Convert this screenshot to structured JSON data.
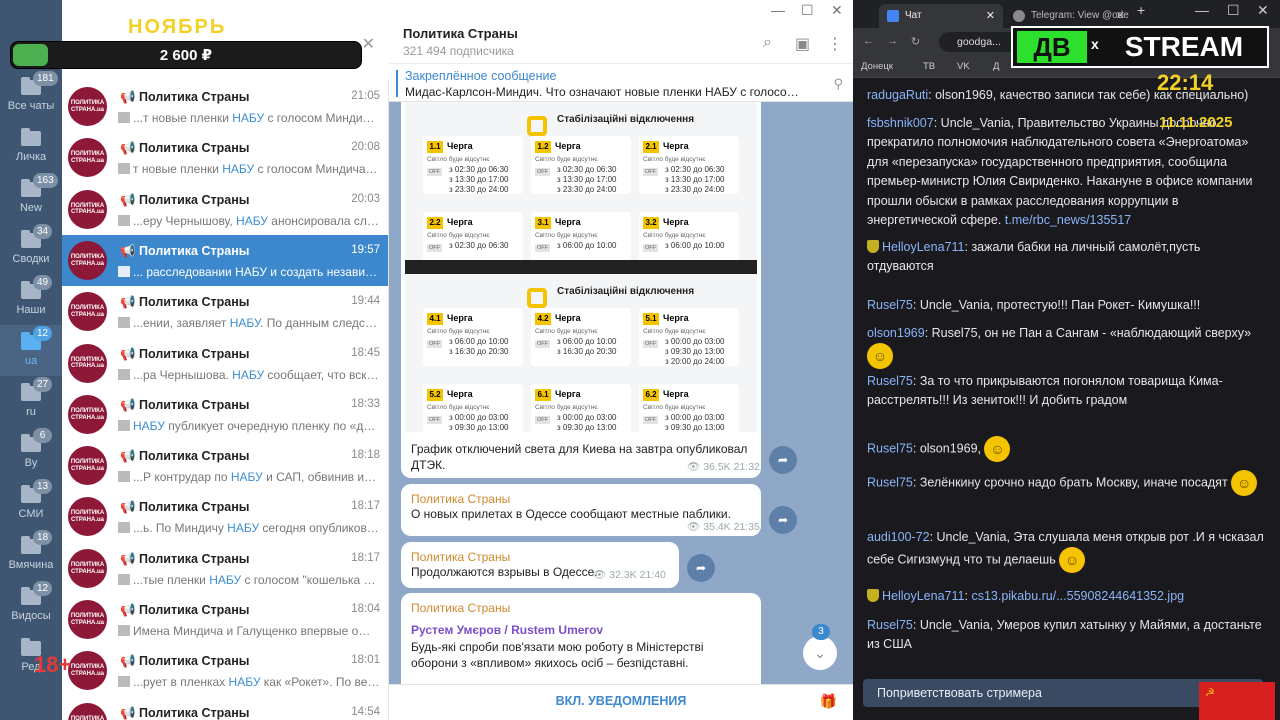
{
  "folders": [
    {
      "label": "Все чаты",
      "badge": "181"
    },
    {
      "label": "Личка",
      "badge": ""
    },
    {
      "label": "New",
      "badge": "163"
    },
    {
      "label": "Сводки",
      "badge": "34"
    },
    {
      "label": "Наши",
      "badge": "49"
    },
    {
      "label": "ua",
      "badge": "12"
    },
    {
      "label": "ru",
      "badge": "27"
    },
    {
      "label": "By",
      "badge": "6"
    },
    {
      "label": "СМИ",
      "badge": "13"
    },
    {
      "label": "Вмячина",
      "badge": "18"
    },
    {
      "label": "Видосы",
      "badge": "12"
    },
    {
      "label": "Ред",
      "badge": ""
    }
  ],
  "overlay": {
    "month": "НОЯБРЬ",
    "price": "2 600 ₽",
    "progress_fraction": 0.1,
    "age": "18+"
  },
  "chats": [
    {
      "name": "Политика Страны",
      "time": "21:05",
      "pre": "...т новые пленки ",
      "hl": "НАБУ",
      "post": " с голосом Миндича и ..."
    },
    {
      "name": "Политика Страны",
      "time": "20:08",
      "pre": "т новые пленки ",
      "hl": "НАБУ",
      "post": " с голосом Миндича и как..."
    },
    {
      "name": "Политика Страны",
      "time": "20:03",
      "pre": "...еру Чернышову, ",
      "hl": "НАБУ",
      "post": " анонсировала следу..."
    },
    {
      "name": "Политика Страны",
      "time": "19:57",
      "pre": "... расследовании ",
      "hl": "НАБУ",
      "post": " и создать независим..."
    },
    {
      "name": "Политика Страны",
      "time": "19:44",
      "pre": "...ении, заявляет ",
      "hl": "НАБУ",
      "post": ". По данным следствия..."
    },
    {
      "name": "Политика Страны",
      "time": "18:45",
      "pre": "...ра Чернышова. ",
      "hl": "НАБУ",
      "post": " сообщает, что вскоре..."
    },
    {
      "name": "Политика Страны",
      "time": "18:33",
      "pre": "",
      "hl": "НАБУ",
      "post": " публикует очередную пленку по «делу..."
    },
    {
      "name": "Политика Страны",
      "time": "18:18",
      "pre": "...Р контрудар по ",
      "hl": "НАБУ",
      "post": " и САП, обвинив их в руков..."
    },
    {
      "name": "Политика Страны",
      "time": "18:17",
      "pre": "...ь. По Миндичу ",
      "hl": "НАБУ",
      "post": " сегодня опубликовало от..."
    },
    {
      "name": "Политика Страны",
      "time": "18:17",
      "pre": "...тые пленки ",
      "hl": "НАБУ",
      "post": " с голосом \"кошелька Зел..."
    },
    {
      "name": "Политика Страны",
      "time": "18:04",
      "pre": "Имена Миндича и Галущенко впервые офиц...",
      "hl": "",
      "post": ""
    },
    {
      "name": "Политика Страны",
      "time": "18:01",
      "pre": "...рует в пленках ",
      "hl": "НАБУ",
      "post": " как «Рокет». По верси..."
    },
    {
      "name": "Политика Страны",
      "time": "14:54",
      "pre": "",
      "hl": "",
      "post": ""
    }
  ],
  "avatar_text": "ПОЛИТИКА СТРАНА.ua",
  "header": {
    "title": "Политика Страны",
    "subscribers": "321 494 подписчика"
  },
  "pinned": {
    "title": "Закреплённое сообщение",
    "text": "Мидас-Карлсон-Миндич. Что означают новые пленки НАБУ с голосом \"ко..."
  },
  "schedule": {
    "title": "Стабілізаційні відключення",
    "queue_word": "Черга",
    "no_light": "Світло буде відсутнє",
    "off": "OFF",
    "card1": [
      {
        "n": "1.1",
        "t": [
          "з 02:30 до 06:30",
          "з 13:30 до 17:00",
          "з 23:30 до 24:00"
        ]
      },
      {
        "n": "1.2",
        "t": [
          "з 02:30 до 06:30",
          "з 13:30 до 17:00",
          "з 23:30 до 24:00"
        ]
      },
      {
        "n": "2.1",
        "t": [
          "з 02:30 до 06:30",
          "з 13:30 до 17:00",
          "з 23:30 до 24:00"
        ]
      },
      {
        "n": "2.2",
        "t": [
          "з 02:30 до 06:30"
        ]
      },
      {
        "n": "3.1",
        "t": [
          "з 06:00 до 10:00"
        ]
      },
      {
        "n": "3.2",
        "t": [
          "з 06:00 до 10:00"
        ]
      }
    ],
    "card2": [
      {
        "n": "4.1",
        "t": [
          "з 06:00 до 10:00",
          "з 16:30 до 20:30"
        ]
      },
      {
        "n": "4.2",
        "t": [
          "з 06:00 до 10:00",
          "з 16:30 до 20:30"
        ]
      },
      {
        "n": "5.1",
        "t": [
          "з 00:00 до 03:00",
          "з 09:30 до 13:00",
          "з 20:00 до 24:00"
        ]
      },
      {
        "n": "5.2",
        "t": [
          "з 00:00 до 03:00",
          "з 09:30 до 13:00"
        ]
      },
      {
        "n": "6.1",
        "t": [
          "з 00:00 до 03:00",
          "з 09:30 до 13:00"
        ]
      },
      {
        "n": "6.2",
        "t": [
          "з 00:00 до 03:00",
          "з 09:30 до 13:00"
        ]
      }
    ]
  },
  "messages": {
    "m1": {
      "caption": "График отключений света для Киева на завтра опубликовал ДТЭК.",
      "views": "36.5K",
      "time": "21:32"
    },
    "m2": {
      "name": "Политика Страны",
      "text": "О новых прилетах в Одессе сообщают местные паблики.",
      "views": "35.4K",
      "time": "21:35"
    },
    "m3": {
      "name": "Политика Страны",
      "text": "Продолжаются взрывы в Одессе.",
      "views": "32.3K",
      "time": "21:40"
    },
    "m4": {
      "name": "Политика Страны",
      "author": "Рустем Умєров / Rustem Umerov",
      "text": "Будь-які спроби пов'язати мою роботу в Міністерстві оборони з «впливом» якихось осіб – безпідставні."
    }
  },
  "unread_count": "3",
  "bottom_button": "ВКЛ. УВЕДОМЛЕНИЯ",
  "browser": {
    "tabs": [
      {
        "label": "Чат"
      },
      {
        "label": "Telegram: View @ode"
      }
    ],
    "url": "goodga...",
    "bookmarks": [
      "Донецк",
      "ТВ",
      "VK",
      "Д"
    ]
  },
  "stream": {
    "logo_left": "ДВ",
    "logo_x": "x",
    "logo_right": "STREAM",
    "clock": "22:14",
    "date": "11.11.2025"
  },
  "chat_messages": [
    {
      "user": "radugaRuti",
      "text": "olson1969, качество записи так себе) как специально)"
    },
    {
      "user": "fsbshnik007",
      "text": "Uncle_Vania, Правительство Украины досрочно прекратило полномочия наблюдательного совета «Энергоатома» для «перезапуска» государственного предприятия, сообщила премьер-министр Юлия Свириденко. Накануне в офисе компании прошли обыски в рамках расследования коррупции в энергетической сфере.",
      "link": "t.me/rbc_news/135517"
    },
    {
      "user": "HelloyLena711",
      "text": "зажали бабки на личный самолёт,пусть отдуваются"
    },
    {
      "user": "Rusel75",
      "text": "Uncle_Vania, протестую!!! Пан Рокет- Кимушка!!!"
    },
    {
      "user": "olson1969",
      "text": "Rusel75, он не Пан а Сангам - «наблюдающий сверху»"
    },
    {
      "user": "Rusel75",
      "text": "За то что прикрываются погонялом товарища Кима- расстрелять!!! Из зениток!!! И добить градом"
    },
    {
      "user": "Rusel75",
      "text": "olson1969,"
    },
    {
      "user": "Rusel75",
      "text": "Зелёнкину срочно надо брать Москву, иначе посадят"
    },
    {
      "user": "audi100-72",
      "text": "Uncle_Vania, Эта слушала меня открыв рот .И я чсказал себе Сигизмунд что ты делаешь"
    },
    {
      "user": "HelloyLena711",
      "text": "",
      "link": "cs13.pikabu.ru/...55908244641352.jpg"
    },
    {
      "user": "Rusel75",
      "text": "Uncle_Vania, Умеров купил хатынку у Майями, а достаньте из США"
    }
  ],
  "greet_button": "Поприветствовать стримера",
  "icons": {
    "search": "search-icon",
    "columns": "columns-icon",
    "more": "more-vertical-icon",
    "gift": "gift-icon",
    "forward": "forward-icon",
    "pin": "pin-icon"
  }
}
